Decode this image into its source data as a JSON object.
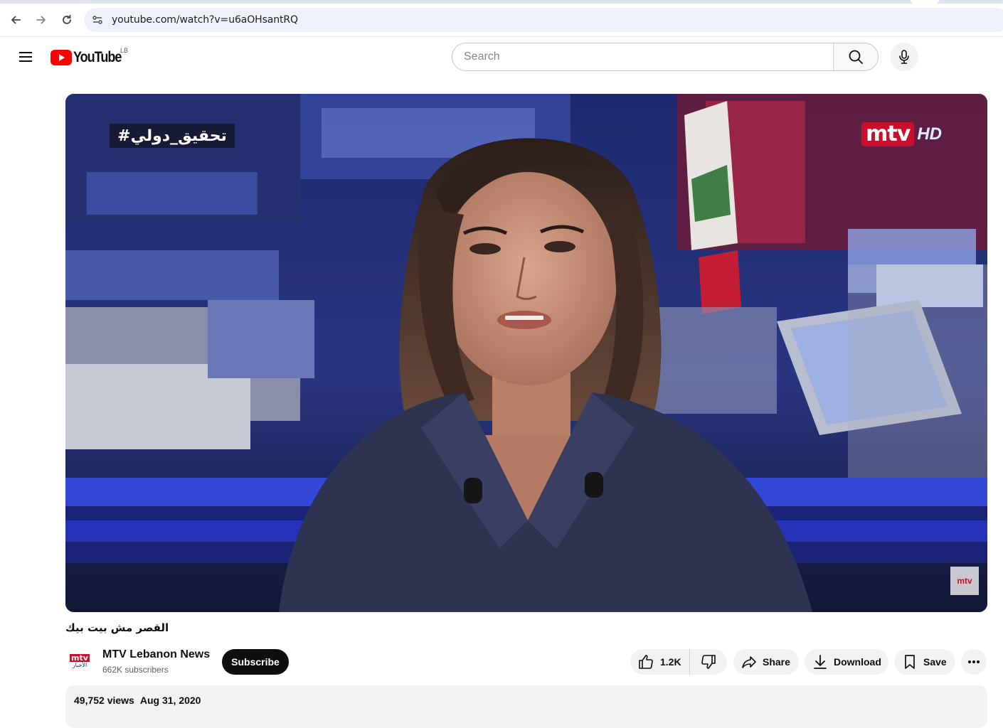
{
  "browser": {
    "url": "youtube.com/watch?v=u6aOHsantRQ"
  },
  "header": {
    "logo_text": "YouTube",
    "country_code": "LB",
    "search_placeholder": "Search"
  },
  "video": {
    "overlay_hashtag": "#تحقيق_دولي",
    "overlay_logo": "mtv",
    "overlay_logo_suffix": "HD",
    "corner_bug": "mtv"
  },
  "info": {
    "title": "القصر مش بيت بيك",
    "channel_name": "MTV Lebanon News",
    "channel_avatar_top": "mtv",
    "channel_avatar_bottom": "الأخبار",
    "subscribers": "662K subscribers",
    "subscribe_label": "Subscribe",
    "like_count": "1.2K",
    "share_label": "Share",
    "download_label": "Download",
    "save_label": "Save",
    "views": "49,752 views",
    "date": "Aug 31, 2020"
  },
  "colors": {
    "brand_red": "#ff0000",
    "mtv_red": "#c8102e",
    "pill_bg": "#f2f2f2"
  }
}
